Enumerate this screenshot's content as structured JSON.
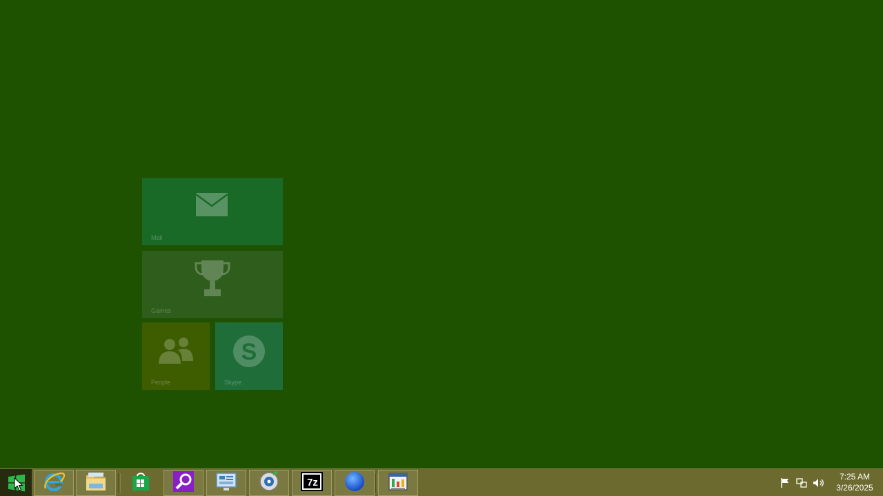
{
  "start_screen": {
    "tiles": [
      {
        "label": "Mail",
        "icon": "mail-icon",
        "color": "#1a6a27"
      },
      {
        "label": "Games",
        "icon": "trophy-icon",
        "color": "#2e5d1c"
      },
      {
        "label": "People",
        "icon": "people-icon",
        "color": "#3e5d00"
      },
      {
        "label": "Skype",
        "icon": "skype-icon",
        "color": "#1f6e3a"
      }
    ]
  },
  "taskbar": {
    "start_icon": "windows-logo-icon",
    "pinned": [
      {
        "name": "Internet Explorer",
        "icon": "internet-explorer-icon"
      },
      {
        "name": "File Explorer",
        "icon": "file-explorer-icon"
      },
      {
        "name": "Store",
        "icon": "store-icon"
      },
      {
        "name": "Search",
        "icon": "search-icon"
      },
      {
        "name": "Control Panel",
        "icon": "control-panel-icon"
      },
      {
        "name": "Media",
        "icon": "media-player-icon"
      },
      {
        "name": "7-Zip",
        "icon": "seven-zip-icon",
        "text": "7z"
      },
      {
        "name": "Browser",
        "icon": "globe-icon"
      },
      {
        "name": "Task Manager",
        "icon": "task-manager-icon"
      }
    ],
    "tray": {
      "icons": [
        "action-center-flag-icon",
        "network-icon",
        "volume-icon"
      ],
      "time": "7:25 AM",
      "date": "3/26/2025"
    }
  },
  "colors": {
    "desktop": "#1f5200",
    "taskbar": "#6d6a30",
    "start_button": "#262b10"
  }
}
